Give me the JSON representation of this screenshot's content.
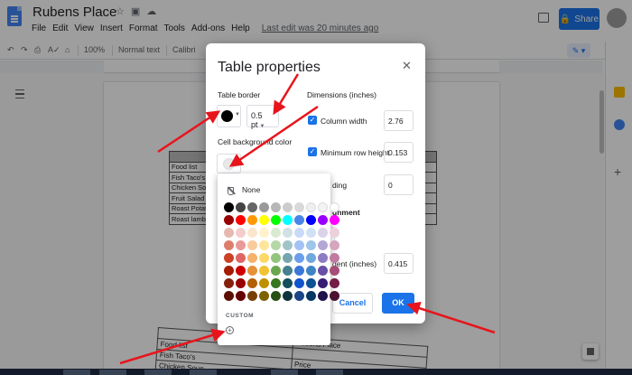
{
  "doc": {
    "title": "Rubens Place",
    "last_edit": "Last edit was 20 minutes ago",
    "menu": [
      "File",
      "Edit",
      "View",
      "Insert",
      "Format",
      "Tools",
      "Add-ons",
      "Help"
    ],
    "share_label": "Share"
  },
  "toolbar": {
    "zoom": "100%",
    "style": "Normal text",
    "font": "Calibri"
  },
  "doc_table": {
    "rows": [
      [
        "Food list",
        ""
      ],
      [
        "Fish Taco's",
        ""
      ],
      [
        "Chicken Soup",
        ""
      ],
      [
        "Fruit Salad",
        ""
      ],
      [
        "Roast Potato",
        ""
      ],
      [
        "Roast lamb",
        ""
      ]
    ]
  },
  "rotated_table": {
    "rows": [
      [
        "",
        "Rubens Place"
      ],
      [
        "Food list",
        ""
      ],
      [
        "Fish Taco's",
        "Price"
      ],
      [
        "Chicken Soup",
        ""
      ]
    ]
  },
  "dialog": {
    "title": "Table properties",
    "close_icon": "close-icon",
    "table_border_label": "Table border",
    "border_width": "0.5 pt",
    "cell_bg_label": "Cell background color",
    "dimensions_label": "Dimensions  (inches)",
    "column_width_label": "Column width",
    "column_width_value": "2.76",
    "min_row_height_label": "Minimum row height",
    "min_row_height_value": "0.153",
    "padding_label": "ding",
    "padding_value": "0",
    "alignment_label": "gnment",
    "indent_label": "dent  (inches)",
    "indent_value": "0.415",
    "cancel_label": "Cancel",
    "ok_label": "OK"
  },
  "picker": {
    "none_label": "None",
    "custom_label": "CUSTOM",
    "add_custom_label": "+",
    "rows": [
      [
        "#000000",
        "#434343",
        "#666666",
        "#999999",
        "#b7b7b7",
        "#cccccc",
        "#d9d9d9",
        "#efefef",
        "#f3f3f3",
        "#ffffff"
      ],
      [
        "#980000",
        "#ff0000",
        "#ff9900",
        "#ffff00",
        "#00ff00",
        "#00ffff",
        "#4a86e8",
        "#0000ff",
        "#9900ff",
        "#ff00ff"
      ],
      [
        "#e6b8af",
        "#f4cccc",
        "#fce5cd",
        "#fff2cc",
        "#d9ead3",
        "#d0e0e3",
        "#c9daf8",
        "#cfe2f3",
        "#d9d2e9",
        "#ead1dc"
      ],
      [
        "#dd7e6b",
        "#ea9999",
        "#f9cb9c",
        "#ffe599",
        "#b6d7a8",
        "#a2c4c9",
        "#a4c2f4",
        "#9fc5e8",
        "#b4a7d6",
        "#d5a6bd"
      ],
      [
        "#cc4125",
        "#e06666",
        "#f6b26b",
        "#ffd966",
        "#93c47d",
        "#76a5af",
        "#6d9eeb",
        "#6fa8dc",
        "#8e7cc3",
        "#c27ba0"
      ],
      [
        "#a61c00",
        "#cc0000",
        "#e69138",
        "#f1c232",
        "#6aa84f",
        "#45818e",
        "#3c78d8",
        "#3d85c6",
        "#674ea7",
        "#a64d79"
      ],
      [
        "#85200c",
        "#990000",
        "#b45f06",
        "#bf9000",
        "#38761d",
        "#134f5c",
        "#1155cc",
        "#0b5394",
        "#351c75",
        "#741b47"
      ],
      [
        "#5b0f00",
        "#660000",
        "#783f04",
        "#7f6000",
        "#274e13",
        "#0c343d",
        "#1c4587",
        "#073763",
        "#20124d",
        "#4c1130"
      ]
    ]
  },
  "colors": {
    "accent": "#1a73e8",
    "annotation": "#e8141b"
  }
}
